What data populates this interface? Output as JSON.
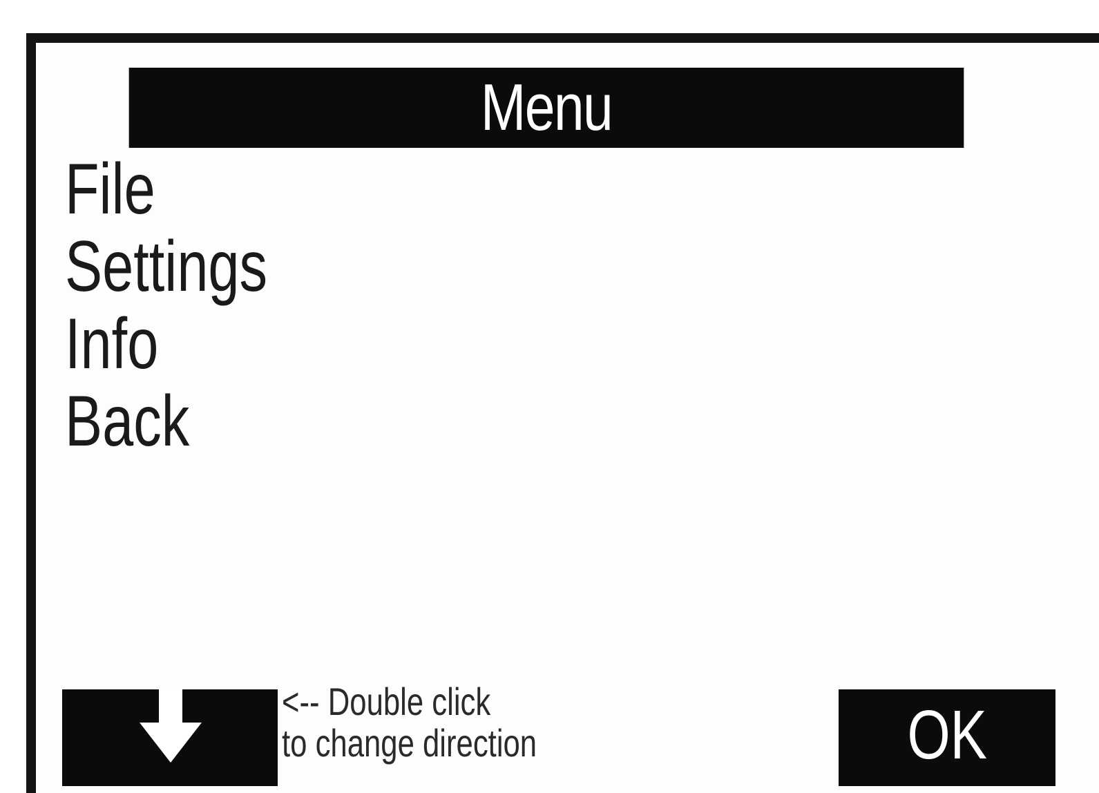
{
  "title": "Menu",
  "menu": {
    "items": [
      {
        "label": "File"
      },
      {
        "label": "Settings"
      },
      {
        "label": "Info"
      },
      {
        "label": "Back"
      }
    ]
  },
  "footer": {
    "direction_icon": "arrow-down-icon",
    "hint_line1": "<-- Double click",
    "hint_line2": "to change direction",
    "ok_label": "OK"
  },
  "colors": {
    "background": "#ffffff",
    "bar": "#0b0b0b",
    "text": "#1a1a1a",
    "inverse_text": "#ffffff"
  }
}
